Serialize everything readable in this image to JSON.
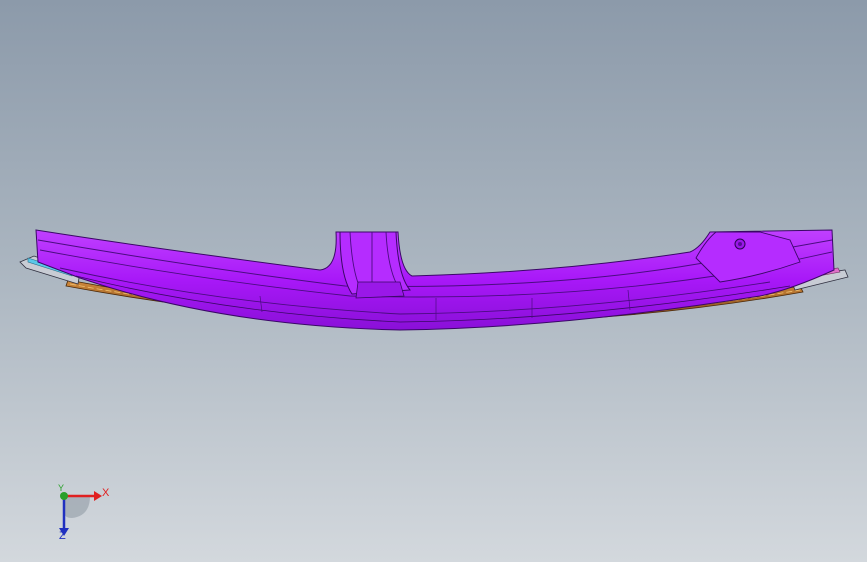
{
  "viewport": {
    "background_top": "#8c9aaa",
    "background_bottom": "#d3d8dd"
  },
  "model": {
    "name": "curved-beam-part",
    "body_color": "#b01fff",
    "body_dark_color": "#7a10c0",
    "flange_color": "#b86f2a",
    "flange_dark_color": "#5a3210",
    "trim_color": "#5ac8e8"
  },
  "triad": {
    "x_label": "X",
    "y_label": "Y",
    "z_label": "Z",
    "x_color": "#e02020",
    "y_color": "#2aa02a",
    "z_color": "#2030c0"
  }
}
